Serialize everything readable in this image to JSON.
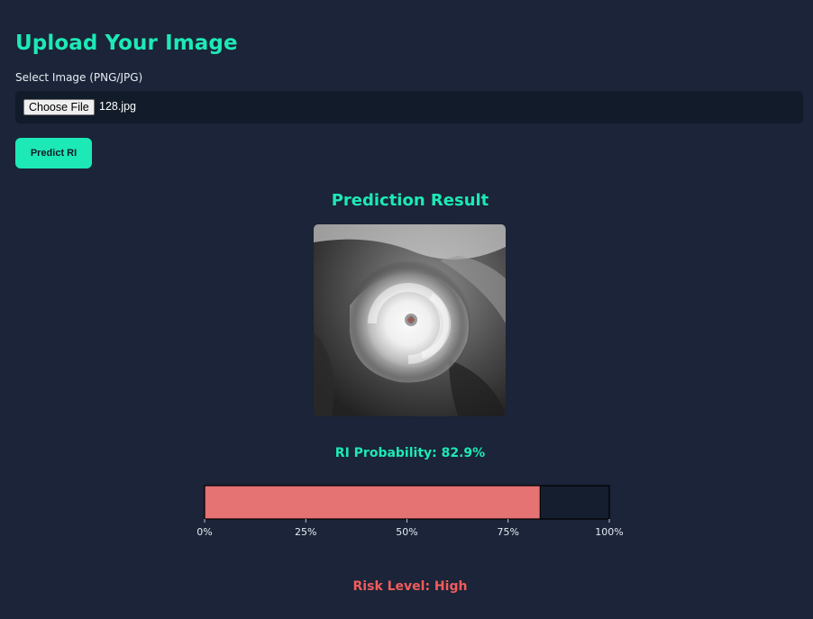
{
  "upload": {
    "title": "Upload Your Image",
    "select_label": "Select Image (PNG/JPG)",
    "choose_file_label": "Choose File",
    "file_name": "128.jpg",
    "predict_label": "Predict RI"
  },
  "result": {
    "title": "Prediction Result",
    "image_icon": "satellite-typhoon-image",
    "probability_text": "RI Probability: 82.9%",
    "risk_text": "Risk Level: High"
  },
  "colors": {
    "accent": "#1de9b6",
    "bar_fill": "#e57373",
    "risk": "#f25c5c",
    "background": "#1b2438"
  },
  "chart_data": {
    "type": "bar",
    "orientation": "horizontal",
    "categories": [
      ""
    ],
    "values": [
      82.9
    ],
    "xlim": [
      0,
      100
    ],
    "xticks": [
      "0%",
      "25%",
      "50%",
      "75%",
      "100%"
    ],
    "title": "",
    "xlabel": "",
    "ylabel": "",
    "grid": false
  }
}
